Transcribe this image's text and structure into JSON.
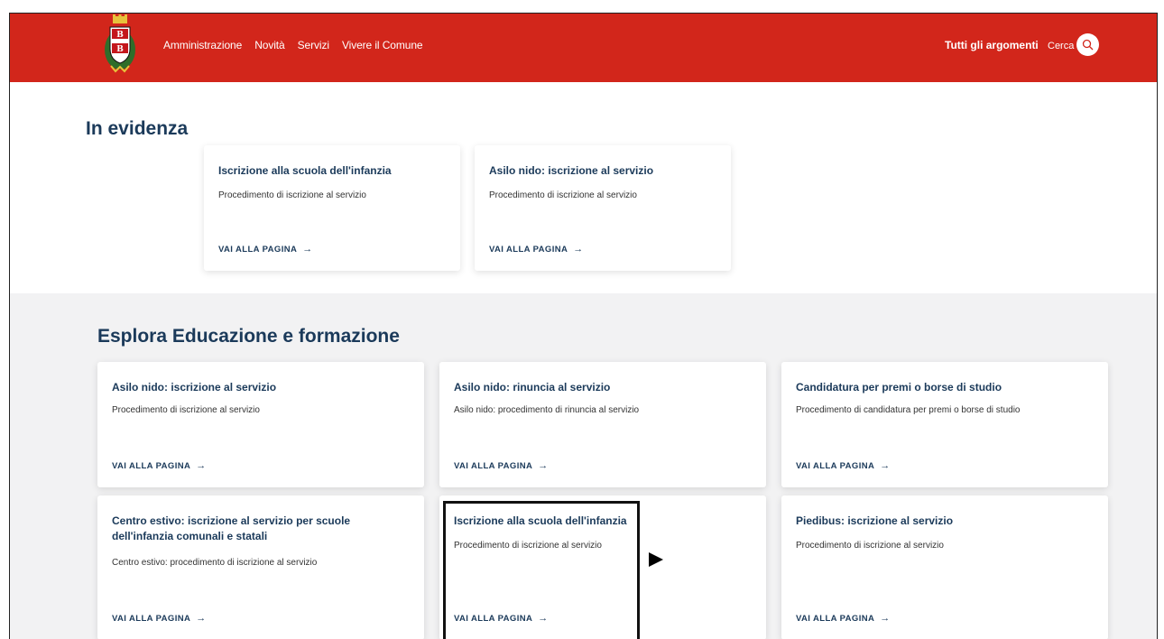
{
  "header": {
    "nav": [
      "Amministrazione",
      "Novità",
      "Servizi",
      "Vivere il Comune"
    ],
    "topics_label": "Tutti gli argomenti",
    "search_label": "Cerca",
    "brand_color": "#d2261b"
  },
  "featured": {
    "title": "In evidenza",
    "cards": [
      {
        "title": "Iscrizione alla scuola dell'infanzia",
        "desc": "Procedimento di iscrizione al servizio",
        "link": "VAI ALLA PAGINA"
      },
      {
        "title": "Asilo nido: iscrizione al servizio",
        "desc": "Procedimento di iscrizione al servizio",
        "link": "VAI ALLA PAGINA"
      }
    ]
  },
  "explore": {
    "title": "Esplora Educazione e formazione",
    "cards": [
      {
        "title": "Asilo nido: iscrizione al servizio",
        "desc": "Procedimento di iscrizione al servizio",
        "link": "VAI ALLA PAGINA"
      },
      {
        "title": "Asilo nido: rinuncia al servizio",
        "desc": "Asilo nido: procedimento di rinuncia al servizio",
        "link": "VAI ALLA PAGINA"
      },
      {
        "title": "Candidatura per premi o borse di studio",
        "desc": "Procedimento di candidatura per premi o borse di studio",
        "link": "VAI ALLA PAGINA"
      },
      {
        "title": "Centro estivo: iscrizione al servizio per scuole dell'infanzia comunali e statali",
        "desc": "Centro estivo: procedimento di iscrizione al servizio",
        "link": "VAI ALLA PAGINA"
      },
      {
        "title": "Iscrizione alla scuola dell'infanzia",
        "desc": "Procedimento di iscrizione al servizio",
        "link": "VAI ALLA PAGINA"
      },
      {
        "title": "Piedibus: iscrizione al servizio",
        "desc": "Procedimento di iscrizione al servizio",
        "link": "VAI ALLA PAGINA"
      }
    ]
  }
}
